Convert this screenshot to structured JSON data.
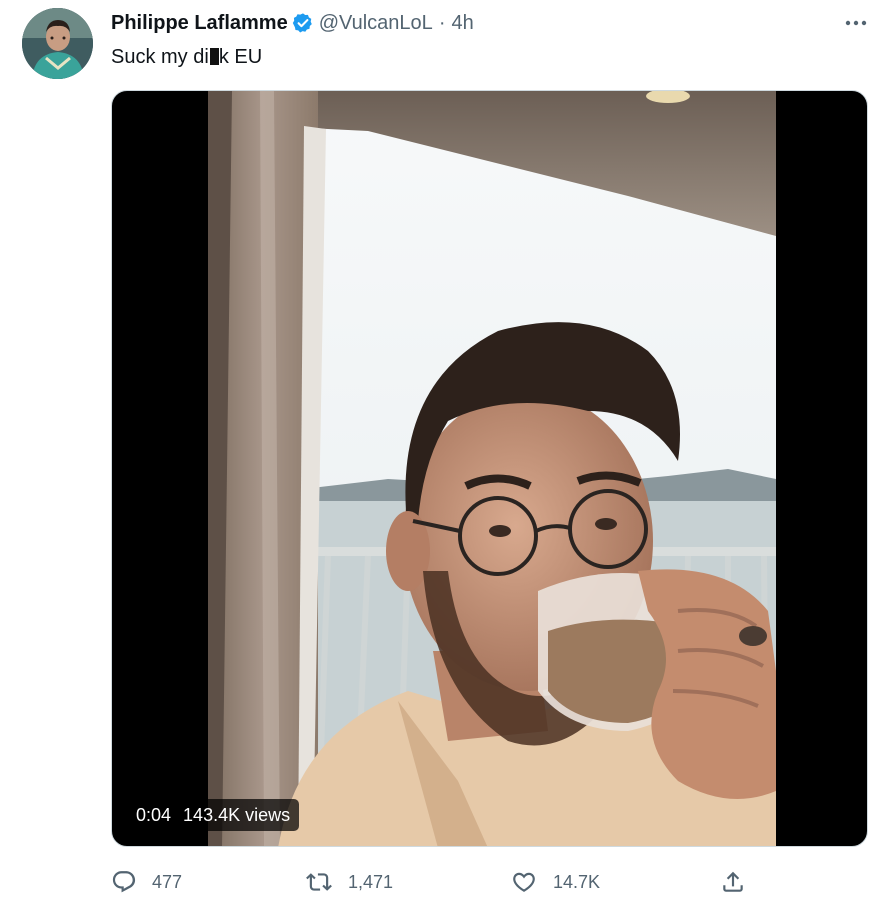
{
  "tweet": {
    "author": {
      "display_name": "Philippe Laflamme",
      "handle": "@VulcanLoL",
      "verified": true,
      "avatar_icon": "user-avatar"
    },
    "separator": "·",
    "time": "4h",
    "text_before": "Suck my di",
    "text_after": "k EU",
    "more_icon": "more-horizontal-icon",
    "media": {
      "type": "video",
      "duration": "0:04",
      "views": "143.4K views"
    },
    "stats": {
      "replies": "477",
      "retweets": "1,471",
      "likes": "14.7K"
    },
    "icons": {
      "reply": "reply-icon",
      "retweet": "retweet-icon",
      "like": "heart-icon",
      "share": "share-icon"
    },
    "colors": {
      "verified": "#1d9bf0",
      "secondary_text": "#536471",
      "primary_text": "#0f1419"
    }
  }
}
